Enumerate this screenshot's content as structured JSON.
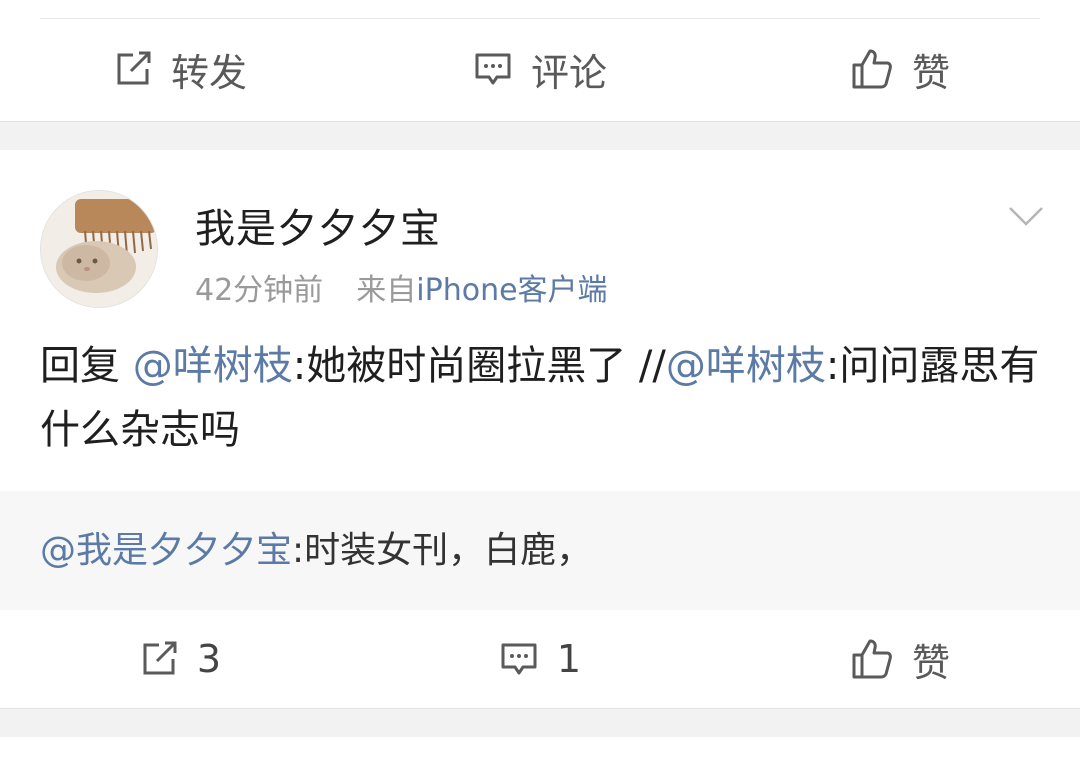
{
  "top_actions": {
    "repost_label": "转发",
    "comment_label": "评论",
    "like_label": "赞"
  },
  "post": {
    "username": "我是夕夕夕宝",
    "time": "42分钟前",
    "source_prefix": "来自",
    "source": "iPhone客户端",
    "text": {
      "reply_prefix": "回复",
      "mention_1": "@咩树枝",
      "content_1": ":她被时尚圈拉黑了 //",
      "mention_2": "@咩树枝",
      "content_2": ":问问露思有什么杂志吗"
    },
    "reply": {
      "mention": "@我是夕夕夕宝",
      "content": ":时装女刊，白鹿，"
    },
    "actions": {
      "repost_count": "3",
      "comment_count": "1",
      "like_label": "赞"
    }
  },
  "icons": {
    "repost": "repost-icon",
    "comment": "comment-icon",
    "like": "thumbs-up-icon",
    "more": "chevron-down-icon",
    "avatar": "hamster-avatar"
  },
  "colors": {
    "link": "#5b7aa6",
    "meta": "#9a9a9a",
    "background": "#f2f2f2",
    "reply_bg": "#f7f7f7"
  }
}
